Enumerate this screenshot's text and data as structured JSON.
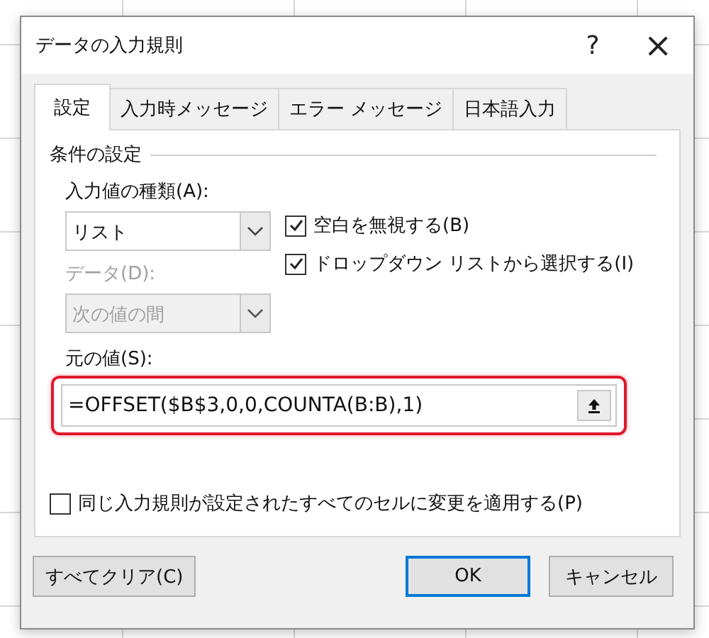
{
  "window": {
    "title": "データの入力規則",
    "help": "?",
    "close": "×"
  },
  "tabs": [
    {
      "label": "設定",
      "selected": true
    },
    {
      "label": "入力時メッセージ",
      "selected": false
    },
    {
      "label": "エラー メッセージ",
      "selected": false
    },
    {
      "label": "日本語入力",
      "selected": false
    }
  ],
  "group_title": "条件の設定",
  "allow": {
    "label": "入力値の種類(A):",
    "value": "リスト",
    "disabled": false
  },
  "data": {
    "label": "データ(D):",
    "value": "次の値の間",
    "disabled": true
  },
  "options": [
    {
      "label": "空白を無視する(B)",
      "checked": true
    },
    {
      "label": "ドロップダウン リストから選択する(I)",
      "checked": true
    }
  ],
  "source": {
    "label": "元の値(S):",
    "value": "=OFFSET($B$3,0,0,COUNTA(B:B),1)",
    "highlighted": true
  },
  "apply_all": {
    "label": "同じ入力規則が設定されたすべてのセルに変更を適用する(P)",
    "checked": false
  },
  "buttons": [
    {
      "label": "すべてクリア(C)",
      "kind": "secondary"
    },
    {
      "label": "OK",
      "kind": "default"
    },
    {
      "label": "キャンセル",
      "kind": "secondary"
    }
  ]
}
